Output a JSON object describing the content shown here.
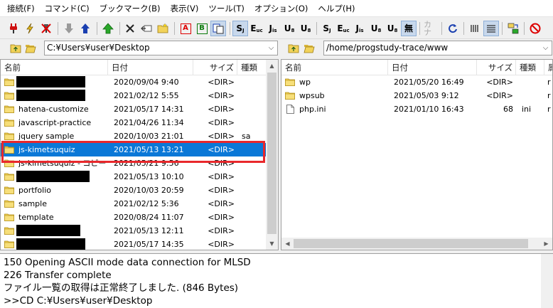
{
  "menubar": {
    "items": [
      "接続(F)",
      "コマンド(C)",
      "ブックマーク(B)",
      "表示(V)",
      "ツール(T)",
      "オプション(O)",
      "ヘルプ(H)"
    ]
  },
  "toolbar": {
    "sjis_label": "S",
    "euc_label": "E",
    "jis_label": "J",
    "utf8n_label": "U",
    "utf8_label": "U",
    "sjis2_label": "S",
    "euc2_label": "E",
    "jis2_label": "J",
    "utf8n2_label": "U",
    "utf8_2_label": "U",
    "mu_label": "無",
    "kana_label": "カナ",
    "ascii_label": "A",
    "binary_label": "B"
  },
  "local": {
    "path": "C:¥Users¥user¥Desktop",
    "columns": [
      "名前",
      "日付",
      "サイズ",
      "種類"
    ],
    "rows": [
      {
        "name": "",
        "date": "2020/09/04  9:40",
        "size": "<DIR>",
        "type": "",
        "redacted": true
      },
      {
        "name": "",
        "date": "2021/02/12  5:55",
        "size": "<DIR>",
        "type": "",
        "redacted": true
      },
      {
        "name": "hatena-customize",
        "date": "2021/05/17 14:31",
        "size": "<DIR>",
        "type": ""
      },
      {
        "name": "javascript-practice",
        "date": "2021/04/26 11:34",
        "size": "<DIR>",
        "type": ""
      },
      {
        "name": "jquery sample",
        "date": "2020/10/03 21:01",
        "size": "<DIR>",
        "type": "sa"
      },
      {
        "name": "js-kimetsuquiz",
        "date": "2021/05/13 13:21",
        "size": "<DIR>",
        "type": "",
        "selected": true
      },
      {
        "name": "js-kimetsuquiz - コピー",
        "date": "2021/05/21  9:56",
        "size": "<DIR>",
        "type": ""
      },
      {
        "name": "",
        "date": "2021/05/13 10:10",
        "size": "<DIR>",
        "type": "",
        "redacted": true
      },
      {
        "name": "portfolio",
        "date": "2020/10/03 20:59",
        "size": "<DIR>",
        "type": ""
      },
      {
        "name": "sample",
        "date": "2021/02/12  5:36",
        "size": "<DIR>",
        "type": ""
      },
      {
        "name": "template",
        "date": "2020/08/24 11:07",
        "size": "<DIR>",
        "type": ""
      },
      {
        "name": "",
        "date": "2021/05/13 12:11",
        "size": "<DIR>",
        "type": "",
        "redacted": true
      },
      {
        "name": "",
        "date": "2021/05/17 14:35",
        "size": "<DIR>",
        "type": "",
        "redacted": true
      }
    ]
  },
  "remote": {
    "path": "/home/progstudy-trace/www",
    "columns": [
      "名前",
      "日付",
      "サイズ",
      "種類",
      "属"
    ],
    "rows": [
      {
        "name": "wp",
        "date": "2021/05/20 16:49",
        "size": "<DIR>",
        "type": "",
        "attr": "r",
        "kind": "folder"
      },
      {
        "name": "wpsub",
        "date": "2021/05/03  9:12",
        "size": "<DIR>",
        "type": "",
        "attr": "r",
        "kind": "folder"
      },
      {
        "name": "php.ini",
        "date": "2021/01/10 16:43",
        "size": "68",
        "type": "ini",
        "attr": "r",
        "kind": "file"
      }
    ]
  },
  "log": {
    "lines": [
      "150 Opening ASCII mode data connection for MLSD",
      "226 Transfer complete",
      "ファイル一覧の取得は正常終了しました. (846 Bytes)",
      ">>CD C:¥Users¥user¥Desktop"
    ]
  },
  "colors": {
    "selection": "#0a78d7",
    "highlight_box": "#e8282c",
    "folder": "#f2d35a"
  }
}
